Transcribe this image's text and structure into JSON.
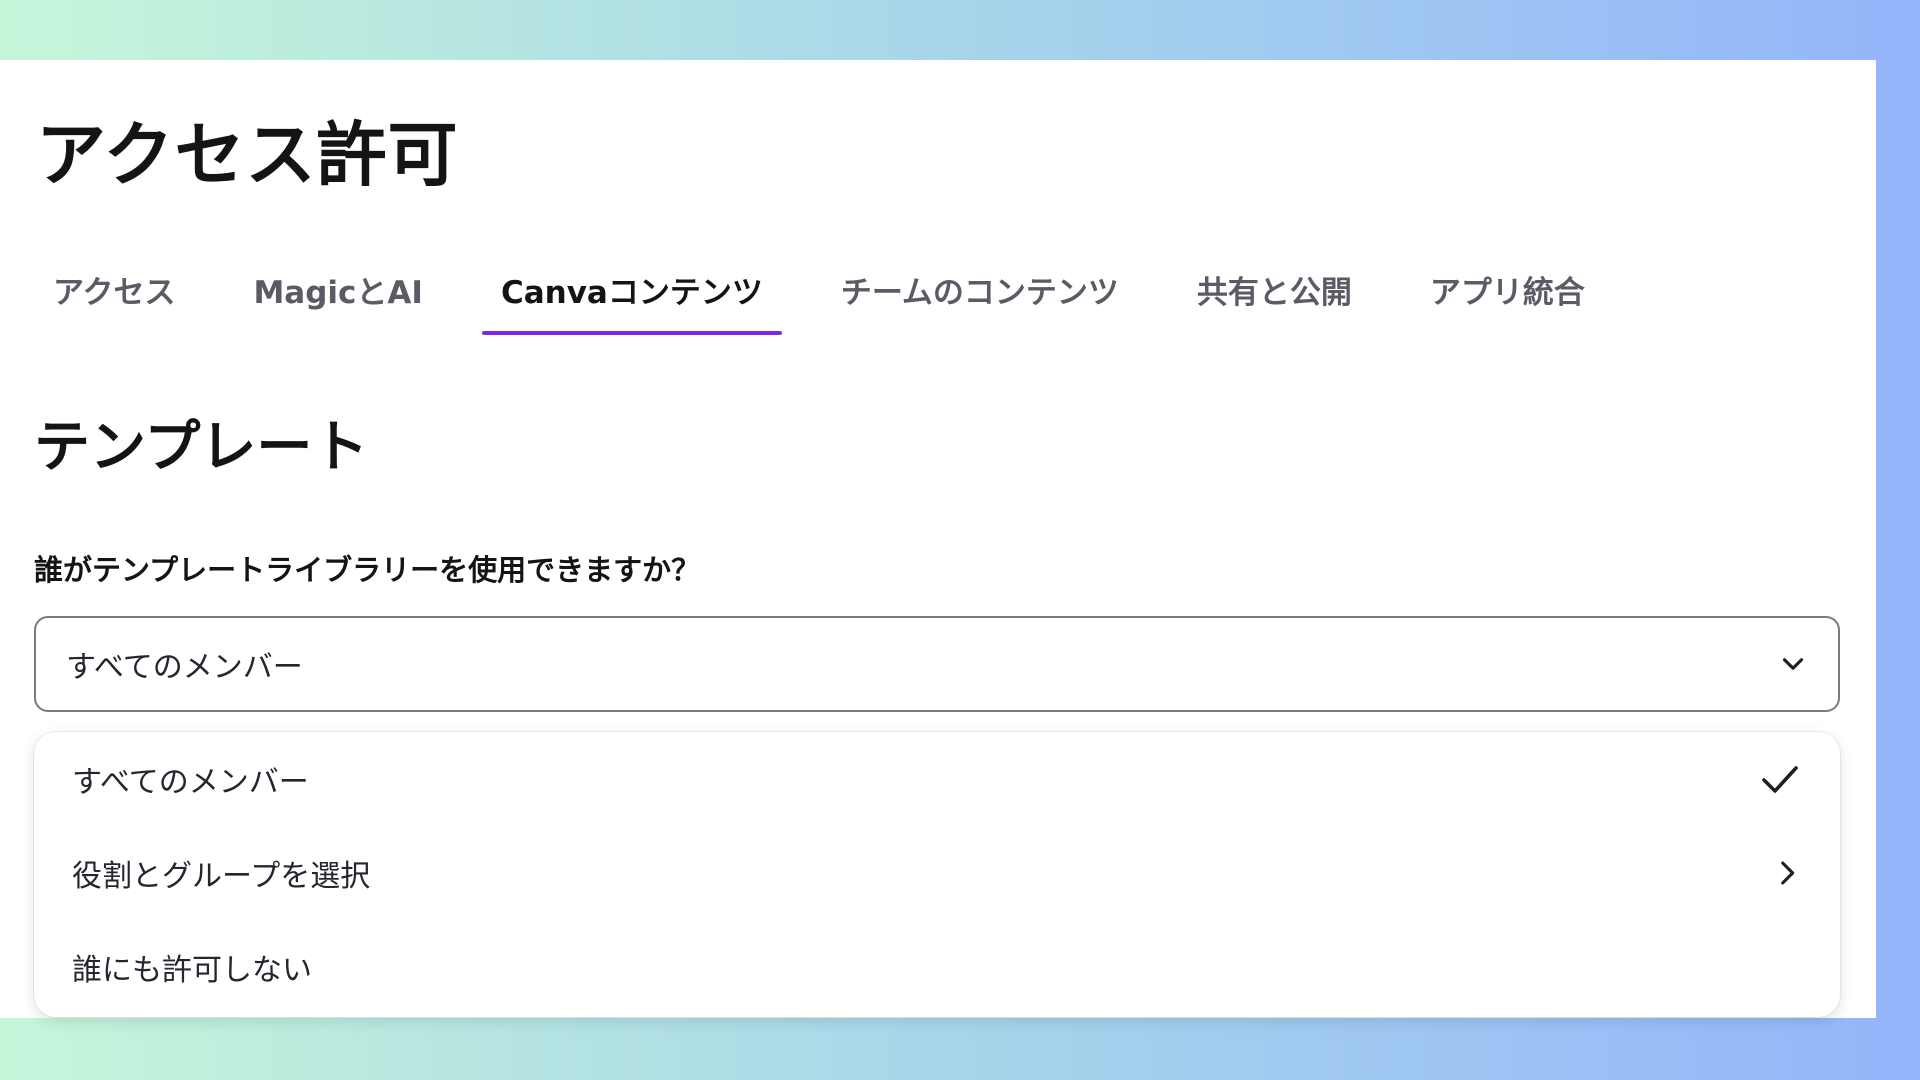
{
  "page": {
    "title": "アクセス許可"
  },
  "tabs": [
    {
      "label": "アクセス",
      "active": false
    },
    {
      "label": "MagicとAI",
      "active": false
    },
    {
      "label": "Canvaコンテンツ",
      "active": true
    },
    {
      "label": "チームのコンテンツ",
      "active": false
    },
    {
      "label": "共有と公開",
      "active": false
    },
    {
      "label": "アプリ統合",
      "active": false
    }
  ],
  "section": {
    "title": "テンプレート",
    "question": "誰がテンプレートライブラリーを使用できますか？"
  },
  "select": {
    "value": "すべてのメンバー",
    "icon": "chevron-down-icon"
  },
  "dropdown": {
    "options": [
      {
        "label": "すべてのメンバー",
        "selected": true,
        "icon": "check-icon"
      },
      {
        "label": "役割とグループを選択",
        "selected": false,
        "icon": "chevron-right-icon"
      },
      {
        "label": "誰にも許可しない",
        "selected": false,
        "icon": ""
      }
    ]
  },
  "colors": {
    "accent": "#7d2ae8",
    "text": "#141417",
    "muted_text": "#5b5b66",
    "border": "#7a7a85"
  }
}
